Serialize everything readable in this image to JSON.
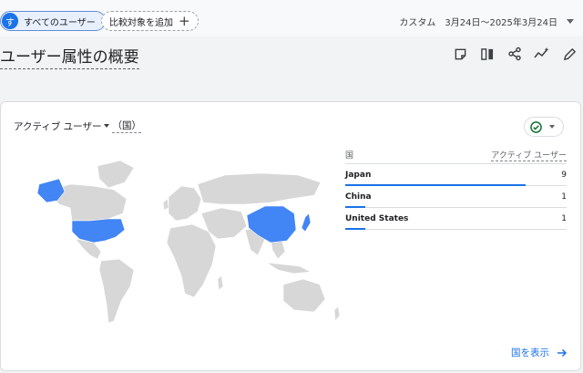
{
  "filter_bar": {
    "segment_badge": "す",
    "segment_label": "すべてのユーザー",
    "add_comparison": "比較対象を追加",
    "add_icon": "+",
    "date_prefix": "カスタム",
    "date_range": "3月24日～2025年3月24日"
  },
  "page": {
    "title": "ユーザー属性の概要"
  },
  "toolbar": {
    "icons": [
      "note-icon",
      "compare-columns-icon",
      "share-icon",
      "insights-icon",
      "edit-icon"
    ]
  },
  "card": {
    "title_metric": "アクティブ ユーザー",
    "title_dimension": "（国）",
    "status_icon": "check-circle-icon",
    "table": {
      "col_dimension": "国",
      "col_metric": "アクティブ ユーザー",
      "rows": [
        {
          "country": "Japan",
          "value": "9",
          "share": 1.0
        },
        {
          "country": "China",
          "value": "1",
          "share": 0.111
        },
        {
          "country": "United States",
          "value": "1",
          "share": 0.111
        }
      ]
    },
    "link_label": "国を表示",
    "highlight_color": "#4285f4",
    "land_color": "#d7d7d7"
  }
}
